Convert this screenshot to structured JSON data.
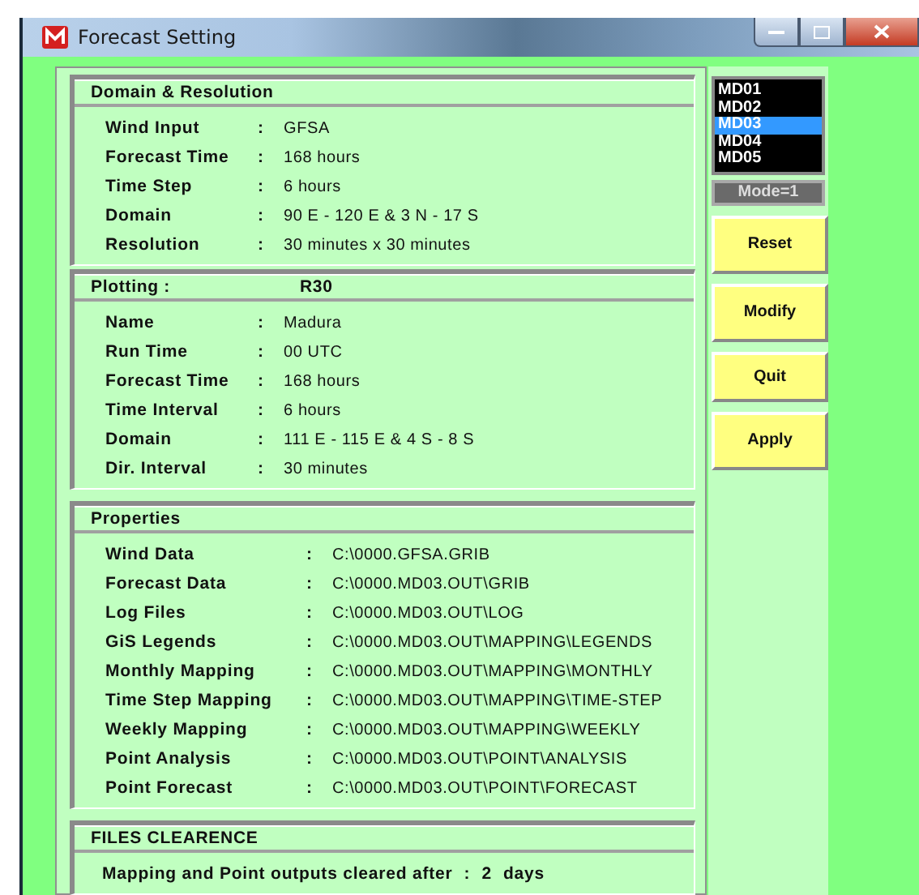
{
  "window": {
    "title": "Forecast Setting"
  },
  "domain_resolution": {
    "title": "Domain & Resolution",
    "separator": ":",
    "rows": [
      {
        "label": "Wind Input",
        "value": "GFSA"
      },
      {
        "label": "Forecast Time",
        "value": "168 hours"
      },
      {
        "label": "Time Step",
        "value": "6 hours"
      },
      {
        "label": "Domain",
        "value": "90 E - 120 E  &  3 N - 17 S"
      },
      {
        "label": "Resolution",
        "value": "30 minutes  x  30 minutes"
      }
    ]
  },
  "plotting": {
    "title": "Plotting :",
    "value": "R30",
    "separator": ":",
    "rows": [
      {
        "label": "Name",
        "value": "Madura"
      },
      {
        "label": "Run Time",
        "value": "00 UTC"
      },
      {
        "label": "Forecast Time",
        "value": "168 hours"
      },
      {
        "label": "Time Interval",
        "value": "6 hours"
      },
      {
        "label": "Domain",
        "value": "111  E - 115  E  &  4 S - 8 S"
      },
      {
        "label": "Dir. Interval",
        "value": "30 minutes"
      }
    ]
  },
  "properties": {
    "title": "Properties",
    "separator": ":",
    "rows": [
      {
        "label": "Wind Data",
        "value": "C:\\0000.GFSA.GRIB"
      },
      {
        "label": "Forecast Data",
        "value": "C:\\0000.MD03.OUT\\GRIB"
      },
      {
        "label": "Log Files",
        "value": "C:\\0000.MD03.OUT\\LOG"
      },
      {
        "label": "GiS Legends",
        "value": "C:\\0000.MD03.OUT\\MAPPING\\LEGENDS"
      },
      {
        "label": "Monthly Mapping",
        "value": "C:\\0000.MD03.OUT\\MAPPING\\MONTHLY"
      },
      {
        "label": "Time Step Mapping",
        "value": "C:\\0000.MD03.OUT\\MAPPING\\TIME-STEP"
      },
      {
        "label": "Weekly Mapping",
        "value": "C:\\0000.MD03.OUT\\MAPPING\\WEEKLY"
      },
      {
        "label": "Point Analysis",
        "value": "C:\\0000.MD03.OUT\\POINT\\ANALYSIS"
      },
      {
        "label": "Point Forecast",
        "value": "C:\\0000.MD03.OUT\\POINT\\FORECAST"
      }
    ]
  },
  "files_clearence": {
    "title": "FILES CLEARENCE",
    "label": "Mapping and Point outputs  cleared after",
    "separator": ":",
    "value": "2",
    "unit": "days"
  },
  "models": [
    {
      "label": "MD01",
      "selected": false
    },
    {
      "label": "MD02",
      "selected": false
    },
    {
      "label": "MD03",
      "selected": true
    },
    {
      "label": "MD04",
      "selected": false
    },
    {
      "label": "MD05",
      "selected": false
    }
  ],
  "mode": "Mode=1",
  "buttons": [
    "Reset",
    "Modify",
    "Quit",
    "Apply"
  ]
}
